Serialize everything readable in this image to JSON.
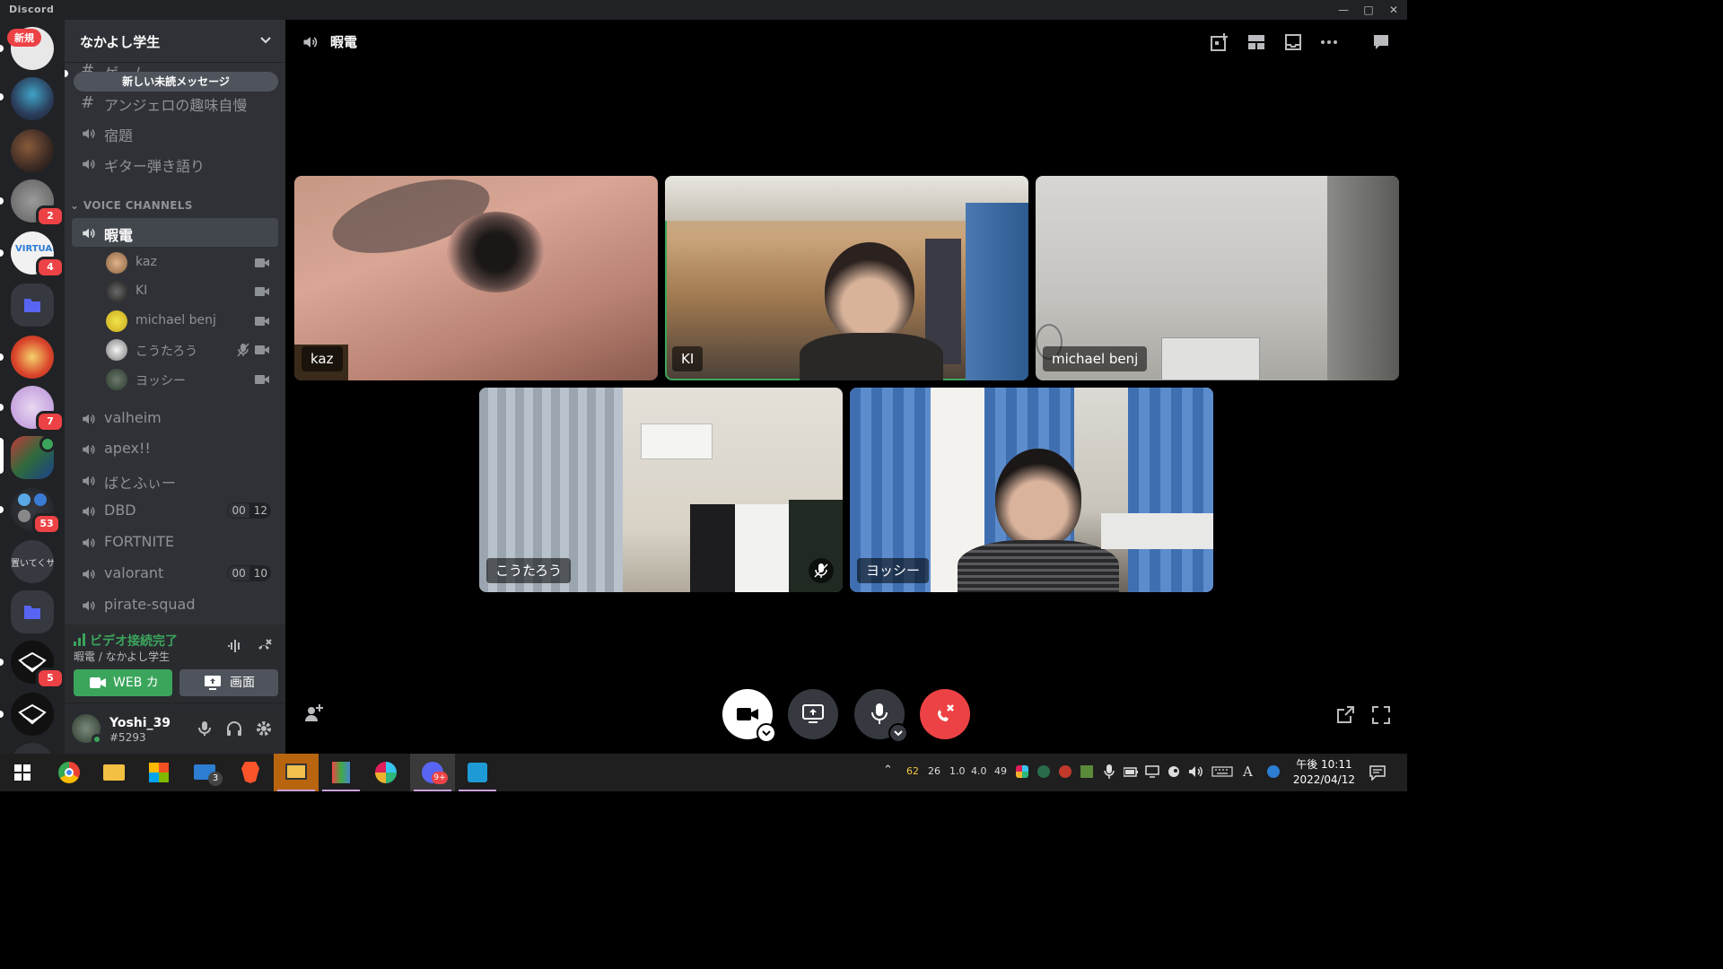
{
  "window": {
    "app_name": "Discord"
  },
  "servers": [
    {
      "id": "s1",
      "badge": ""
    },
    {
      "id": "s2",
      "badge": ""
    },
    {
      "id": "s3",
      "badge": ""
    },
    {
      "id": "s4",
      "badge": "2"
    },
    {
      "id": "s5",
      "badge": "4",
      "text": "VIRTUAL"
    },
    {
      "id": "s6",
      "badge": ""
    },
    {
      "id": "s7",
      "badge": ""
    },
    {
      "id": "s8",
      "badge": "7"
    },
    {
      "id": "s9",
      "badge": ""
    },
    {
      "id": "s10",
      "badge": "53"
    },
    {
      "id": "s11",
      "badge": "",
      "text": "置いてくサ"
    },
    {
      "id": "s12",
      "badge": ""
    },
    {
      "id": "s13",
      "badge": "5"
    },
    {
      "id": "s14",
      "badge": ""
    }
  ],
  "rail_new_label": "新規",
  "guild": {
    "name": "なかよし学生",
    "unread_banner": "新しい未読メッセージ",
    "text_channels": [
      {
        "name": "ゲーム"
      },
      {
        "name": "アンジェロの趣味自慢"
      }
    ],
    "extra_channels": [
      {
        "name": "宿題"
      },
      {
        "name": "ギター弾き語り"
      }
    ],
    "voice_category": "VOICE CHANNELS",
    "active_voice": "暇電",
    "voice_users": [
      {
        "name": "kaz",
        "muted": false
      },
      {
        "name": "KI",
        "muted": false
      },
      {
        "name": "michael benj",
        "muted": false
      },
      {
        "name": "こうたろう",
        "muted": true
      },
      {
        "name": "ヨッシー",
        "muted": false
      }
    ],
    "voice_channels": [
      {
        "name": "valheim",
        "count_a": "",
        "count_b": ""
      },
      {
        "name": "apex!!",
        "count_a": "",
        "count_b": ""
      },
      {
        "name": "ばとふぃー",
        "count_a": "",
        "count_b": ""
      },
      {
        "name": "DBD",
        "count_a": "00",
        "count_b": "12"
      },
      {
        "name": "FORTNITE",
        "count_a": "",
        "count_b": ""
      },
      {
        "name": "valorant",
        "count_a": "00",
        "count_b": "10"
      },
      {
        "name": "pirate-squad",
        "count_a": "",
        "count_b": ""
      }
    ]
  },
  "voice_panel": {
    "status": "ビデオ接続完了",
    "location": "暇電 / なかよし学生",
    "camera_button": "WEB カ",
    "screen_button": "画面"
  },
  "user": {
    "name": "Yoshi_39",
    "tag": "#5293"
  },
  "call": {
    "title": "暇電",
    "tiles": [
      {
        "label": "kaz",
        "muted": false
      },
      {
        "label": "KI",
        "muted": false
      },
      {
        "label": "michael benj",
        "muted": false
      },
      {
        "label": "こうたろう",
        "muted": true
      },
      {
        "label": "ヨッシー",
        "muted": false
      }
    ]
  },
  "taskbar": {
    "mail_badge": "3",
    "discord_badge": "9+",
    "tray_stats": [
      "62",
      "26",
      "1.0",
      "4.0",
      "49"
    ],
    "ime": "A",
    "time": "午後 10:11",
    "date": "2022/04/12"
  },
  "colors": {
    "accent_green": "#3ba55c",
    "danger_red": "#ed4245",
    "blurple": "#5865f2"
  }
}
